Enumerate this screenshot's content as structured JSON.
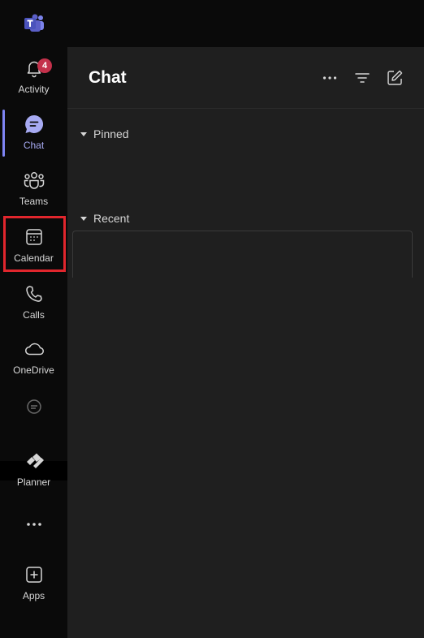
{
  "app": {
    "brand_color": "#5b5fc7",
    "accent_color": "#7f85f5"
  },
  "rail": {
    "items": [
      {
        "label": "Activity",
        "icon": "bell-icon",
        "badge": "4"
      },
      {
        "label": "Chat",
        "icon": "chat-icon",
        "active": true
      },
      {
        "label": "Teams",
        "icon": "teams-icon"
      },
      {
        "label": "Calendar",
        "icon": "calendar-icon",
        "highlighted": true
      },
      {
        "label": "Calls",
        "icon": "phone-icon"
      },
      {
        "label": "OneDrive",
        "icon": "cloud-icon"
      },
      {
        "label": "Planner",
        "icon": "planner-icon"
      },
      {
        "label": "Apps",
        "icon": "add-apps-icon"
      }
    ],
    "more_icon": "more-icon"
  },
  "chat": {
    "title": "Chat",
    "actions": [
      "more-options-icon",
      "filter-icon",
      "new-chat-icon"
    ],
    "sections": [
      {
        "label": "Pinned"
      },
      {
        "label": "Recent"
      }
    ]
  }
}
